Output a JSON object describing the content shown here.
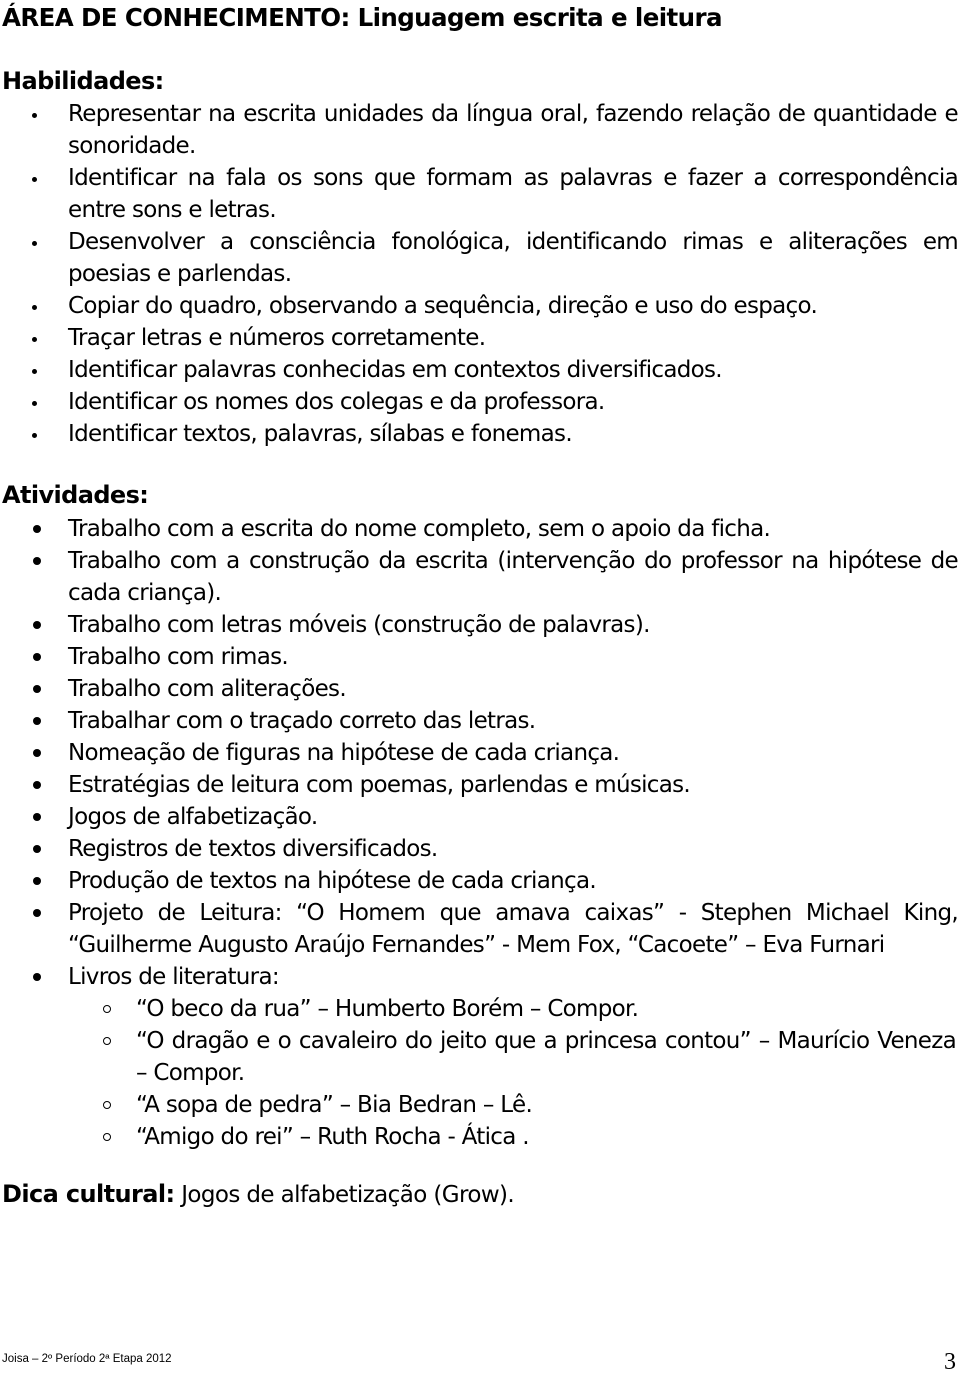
{
  "title": "ÁREA DE CONHECIMENTO: Linguagem escrita e leitura",
  "habilidades": {
    "heading": "Habilidades:",
    "items": [
      "Representar na escrita unidades da língua oral, fazendo relação de quantidade e sonoridade.",
      "Identificar na fala os sons que formam as palavras e fazer a correspondência entre sons e letras.",
      "Desenvolver a consciência fonológica, identificando rimas e aliterações em poesias e parlendas.",
      "Copiar do quadro, observando a sequência, direção e uso do espaço.",
      "Traçar letras e números corretamente.",
      "Identificar palavras conhecidas em contextos diversificados.",
      "Identificar os nomes dos colegas e da professora.",
      "Identificar textos, palavras, sílabas e fonemas."
    ]
  },
  "atividades": {
    "heading": "Atividades:",
    "items": [
      "Trabalho com a escrita do nome completo, sem o apoio da ficha.",
      "Trabalho com a construção da escrita (intervenção do professor na hipótese de cada criança).",
      "Trabalho com  letras móveis (construção de palavras).",
      "Trabalho com rimas.",
      "Trabalho com aliterações.",
      "Trabalhar com o traçado correto das letras.",
      "Nomeação de figuras na hipótese de cada criança.",
      "Estratégias de leitura com poemas, parlendas e músicas.",
      "Jogos de alfabetização.",
      "Registros de textos diversificados.",
      "Produção de textos na hipótese de cada criança.",
      "Projeto de Leitura: “O Homem que amava caixas” - Stephen Michael King, “Guilherme Augusto Araújo Fernandes” -  Mem Fox, “Cacoete” – Eva Furnari",
      "Livros de literatura:"
    ],
    "livros": [
      "“O beco da rua” – Humberto Borém – Compor.",
      "“O dragão e o cavaleiro do jeito que a princesa contou” – Maurício Veneza – Compor.",
      "“A sopa de pedra” – Bia Bedran – Lê.",
      "“Amigo do rei” – Ruth Rocha - Ática ."
    ]
  },
  "dica": {
    "label": "Dica cultural:",
    "text": " Jogos de alfabetização (Grow)."
  },
  "footer": {
    "left": "Joisa – 2º Período 2ª Etapa 2012",
    "page_number": "3"
  }
}
